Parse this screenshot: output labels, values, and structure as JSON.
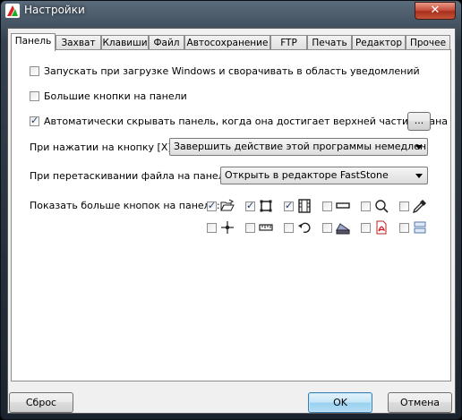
{
  "window": {
    "title": "Настройки",
    "close_label": "✕"
  },
  "tabs": [
    {
      "label": "Панель"
    },
    {
      "label": "Захват"
    },
    {
      "label": "Клавиши"
    },
    {
      "label": "Файл"
    },
    {
      "label": "Автосохранение"
    },
    {
      "label": "FTP"
    },
    {
      "label": "Печать"
    },
    {
      "label": "Редактор"
    },
    {
      "label": "Прочее"
    }
  ],
  "options": {
    "startup": {
      "label": "Запускать при загрузке Windows и сворачивать в область уведомлений",
      "checked": false
    },
    "big_buttons": {
      "label": "Большие кнопки на панели",
      "checked": false
    },
    "autohide": {
      "label": "Автоматически скрывать панель, когда она достигает верхней части экрана",
      "checked": true,
      "more_label": "..."
    }
  },
  "button_click": {
    "label": "При нажатии на кнопку [X]:",
    "value": "Завершить действие этой программы немедленно"
  },
  "drag_file": {
    "label": "При перетаскивании файла на панель:",
    "value": "Открыть в редакторе FastStone"
  },
  "more_buttons": {
    "label": "Показать больше кнопок на панели:",
    "row1": [
      {
        "icon": "open-folder-icon",
        "checked": true
      },
      {
        "icon": "crop-frame-icon",
        "checked": true
      },
      {
        "icon": "film-strip-icon",
        "checked": true
      },
      {
        "icon": "minus-bar-icon",
        "checked": false
      },
      {
        "icon": "magnifier-icon",
        "checked": false
      },
      {
        "icon": "color-picker-icon",
        "checked": false
      }
    ],
    "row2": [
      {
        "icon": "crosshair-icon",
        "checked": false
      },
      {
        "icon": "ruler-icon",
        "checked": false
      },
      {
        "icon": "undo-arrow-icon",
        "checked": false
      },
      {
        "icon": "scanner-icon",
        "checked": false
      },
      {
        "icon": "pdf-icon",
        "checked": false
      },
      {
        "icon": "compare-icon",
        "checked": false
      }
    ]
  },
  "footer": {
    "reset_label": "Сброс",
    "ok_label": "OK",
    "cancel_label": "Отмена"
  }
}
